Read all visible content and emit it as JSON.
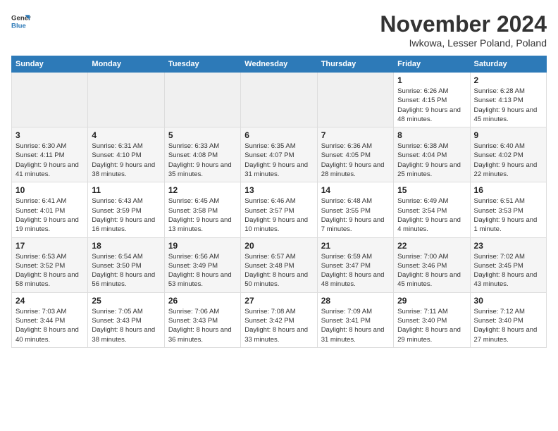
{
  "header": {
    "logo_general": "General",
    "logo_blue": "Blue",
    "month_title": "November 2024",
    "location": "Iwkowa, Lesser Poland, Poland"
  },
  "calendar": {
    "headers": [
      "Sunday",
      "Monday",
      "Tuesday",
      "Wednesday",
      "Thursday",
      "Friday",
      "Saturday"
    ],
    "weeks": [
      [
        {
          "day": "",
          "empty": true
        },
        {
          "day": "",
          "empty": true
        },
        {
          "day": "",
          "empty": true
        },
        {
          "day": "",
          "empty": true
        },
        {
          "day": "",
          "empty": true
        },
        {
          "day": "1",
          "sunrise": "Sunrise: 6:26 AM",
          "sunset": "Sunset: 4:15 PM",
          "daylight": "Daylight: 9 hours and 48 minutes."
        },
        {
          "day": "2",
          "sunrise": "Sunrise: 6:28 AM",
          "sunset": "Sunset: 4:13 PM",
          "daylight": "Daylight: 9 hours and 45 minutes."
        }
      ],
      [
        {
          "day": "3",
          "sunrise": "Sunrise: 6:30 AM",
          "sunset": "Sunset: 4:11 PM",
          "daylight": "Daylight: 9 hours and 41 minutes."
        },
        {
          "day": "4",
          "sunrise": "Sunrise: 6:31 AM",
          "sunset": "Sunset: 4:10 PM",
          "daylight": "Daylight: 9 hours and 38 minutes."
        },
        {
          "day": "5",
          "sunrise": "Sunrise: 6:33 AM",
          "sunset": "Sunset: 4:08 PM",
          "daylight": "Daylight: 9 hours and 35 minutes."
        },
        {
          "day": "6",
          "sunrise": "Sunrise: 6:35 AM",
          "sunset": "Sunset: 4:07 PM",
          "daylight": "Daylight: 9 hours and 31 minutes."
        },
        {
          "day": "7",
          "sunrise": "Sunrise: 6:36 AM",
          "sunset": "Sunset: 4:05 PM",
          "daylight": "Daylight: 9 hours and 28 minutes."
        },
        {
          "day": "8",
          "sunrise": "Sunrise: 6:38 AM",
          "sunset": "Sunset: 4:04 PM",
          "daylight": "Daylight: 9 hours and 25 minutes."
        },
        {
          "day": "9",
          "sunrise": "Sunrise: 6:40 AM",
          "sunset": "Sunset: 4:02 PM",
          "daylight": "Daylight: 9 hours and 22 minutes."
        }
      ],
      [
        {
          "day": "10",
          "sunrise": "Sunrise: 6:41 AM",
          "sunset": "Sunset: 4:01 PM",
          "daylight": "Daylight: 9 hours and 19 minutes."
        },
        {
          "day": "11",
          "sunrise": "Sunrise: 6:43 AM",
          "sunset": "Sunset: 3:59 PM",
          "daylight": "Daylight: 9 hours and 16 minutes."
        },
        {
          "day": "12",
          "sunrise": "Sunrise: 6:45 AM",
          "sunset": "Sunset: 3:58 PM",
          "daylight": "Daylight: 9 hours and 13 minutes."
        },
        {
          "day": "13",
          "sunrise": "Sunrise: 6:46 AM",
          "sunset": "Sunset: 3:57 PM",
          "daylight": "Daylight: 9 hours and 10 minutes."
        },
        {
          "day": "14",
          "sunrise": "Sunrise: 6:48 AM",
          "sunset": "Sunset: 3:55 PM",
          "daylight": "Daylight: 9 hours and 7 minutes."
        },
        {
          "day": "15",
          "sunrise": "Sunrise: 6:49 AM",
          "sunset": "Sunset: 3:54 PM",
          "daylight": "Daylight: 9 hours and 4 minutes."
        },
        {
          "day": "16",
          "sunrise": "Sunrise: 6:51 AM",
          "sunset": "Sunset: 3:53 PM",
          "daylight": "Daylight: 9 hours and 1 minute."
        }
      ],
      [
        {
          "day": "17",
          "sunrise": "Sunrise: 6:53 AM",
          "sunset": "Sunset: 3:52 PM",
          "daylight": "Daylight: 8 hours and 58 minutes."
        },
        {
          "day": "18",
          "sunrise": "Sunrise: 6:54 AM",
          "sunset": "Sunset: 3:50 PM",
          "daylight": "Daylight: 8 hours and 56 minutes."
        },
        {
          "day": "19",
          "sunrise": "Sunrise: 6:56 AM",
          "sunset": "Sunset: 3:49 PM",
          "daylight": "Daylight: 8 hours and 53 minutes."
        },
        {
          "day": "20",
          "sunrise": "Sunrise: 6:57 AM",
          "sunset": "Sunset: 3:48 PM",
          "daylight": "Daylight: 8 hours and 50 minutes."
        },
        {
          "day": "21",
          "sunrise": "Sunrise: 6:59 AM",
          "sunset": "Sunset: 3:47 PM",
          "daylight": "Daylight: 8 hours and 48 minutes."
        },
        {
          "day": "22",
          "sunrise": "Sunrise: 7:00 AM",
          "sunset": "Sunset: 3:46 PM",
          "daylight": "Daylight: 8 hours and 45 minutes."
        },
        {
          "day": "23",
          "sunrise": "Sunrise: 7:02 AM",
          "sunset": "Sunset: 3:45 PM",
          "daylight": "Daylight: 8 hours and 43 minutes."
        }
      ],
      [
        {
          "day": "24",
          "sunrise": "Sunrise: 7:03 AM",
          "sunset": "Sunset: 3:44 PM",
          "daylight": "Daylight: 8 hours and 40 minutes."
        },
        {
          "day": "25",
          "sunrise": "Sunrise: 7:05 AM",
          "sunset": "Sunset: 3:43 PM",
          "daylight": "Daylight: 8 hours and 38 minutes."
        },
        {
          "day": "26",
          "sunrise": "Sunrise: 7:06 AM",
          "sunset": "Sunset: 3:43 PM",
          "daylight": "Daylight: 8 hours and 36 minutes."
        },
        {
          "day": "27",
          "sunrise": "Sunrise: 7:08 AM",
          "sunset": "Sunset: 3:42 PM",
          "daylight": "Daylight: 8 hours and 33 minutes."
        },
        {
          "day": "28",
          "sunrise": "Sunrise: 7:09 AM",
          "sunset": "Sunset: 3:41 PM",
          "daylight": "Daylight: 8 hours and 31 minutes."
        },
        {
          "day": "29",
          "sunrise": "Sunrise: 7:11 AM",
          "sunset": "Sunset: 3:40 PM",
          "daylight": "Daylight: 8 hours and 29 minutes."
        },
        {
          "day": "30",
          "sunrise": "Sunrise: 7:12 AM",
          "sunset": "Sunset: 3:40 PM",
          "daylight": "Daylight: 8 hours and 27 minutes."
        }
      ]
    ]
  }
}
